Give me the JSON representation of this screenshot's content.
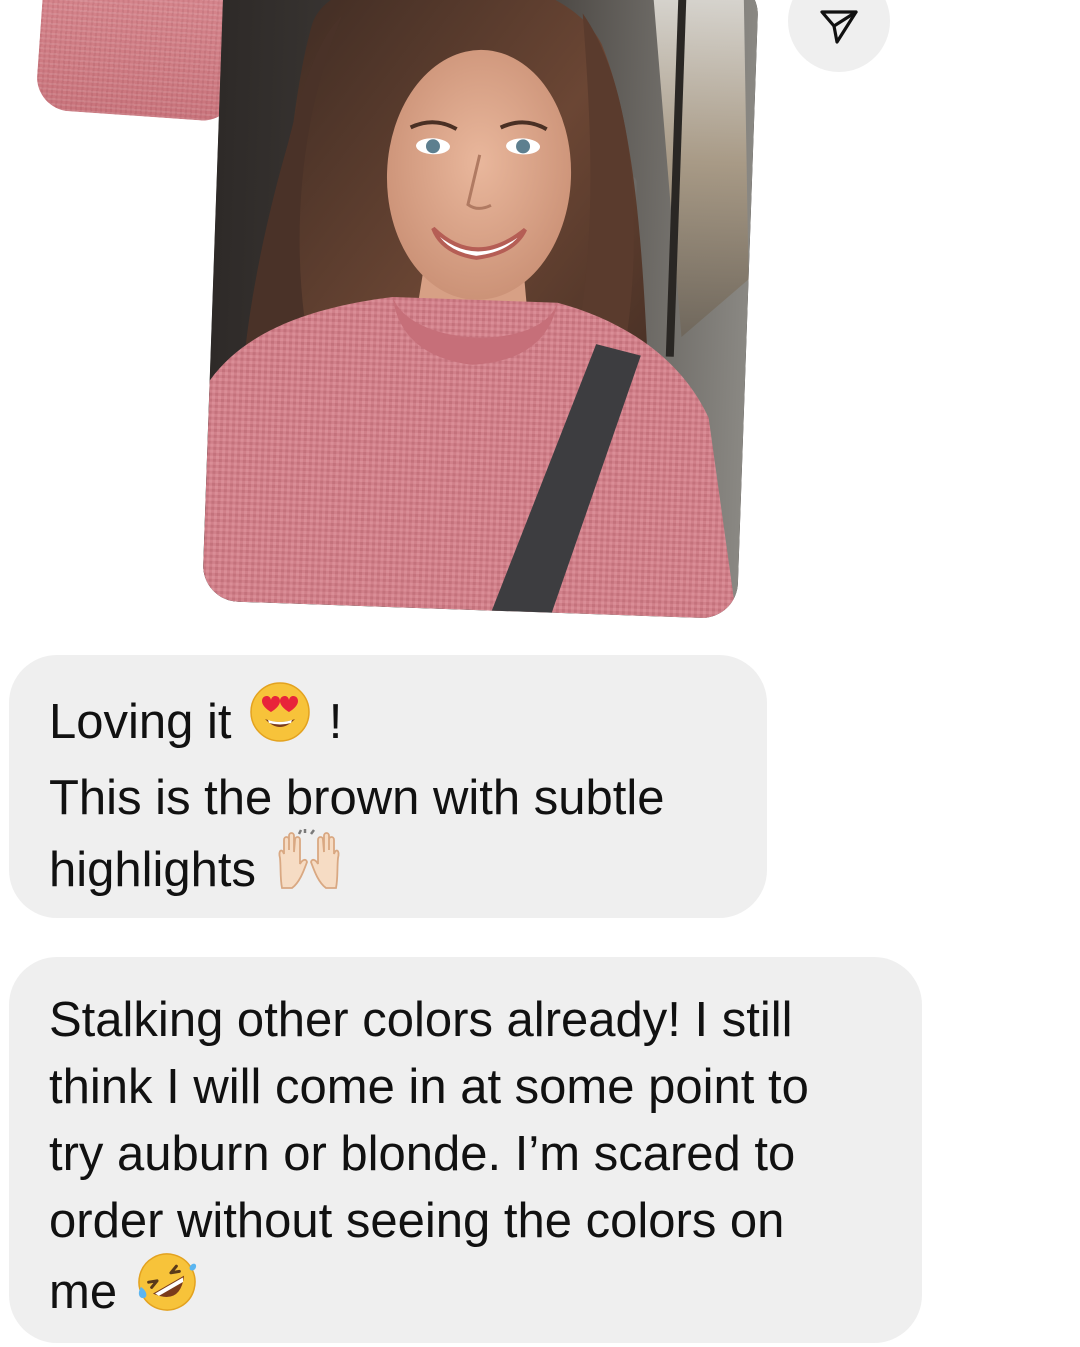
{
  "conversation": {
    "messages": [
      {
        "type": "image",
        "description_icon": "selfie-photo"
      },
      {
        "type": "text",
        "line1_prefix": "Loving it",
        "line1_emoji": "heart-eyes-emoji",
        "line1_suffix": "!",
        "line2": "This is the brown with subtle",
        "line3_prefix": "highlights",
        "line3_emoji": "raising-hands-emoji"
      },
      {
        "type": "text",
        "lines": [
          "Stalking other colors already! I still",
          "think I will come in at some point to",
          "try auburn or blonde. I’m scared to",
          "order without seeing the colors on"
        ],
        "last_line_prefix": "me",
        "last_line_emoji": "rolling-on-floor-laughing-emoji"
      }
    ],
    "share_button": {
      "icon": "paper-plane-icon"
    }
  },
  "colors": {
    "bubble_background": "#efefef",
    "text": "#111111",
    "background": "#ffffff",
    "sweater_pink": "#d2808a",
    "hair_brown": "#5a3a2c"
  }
}
